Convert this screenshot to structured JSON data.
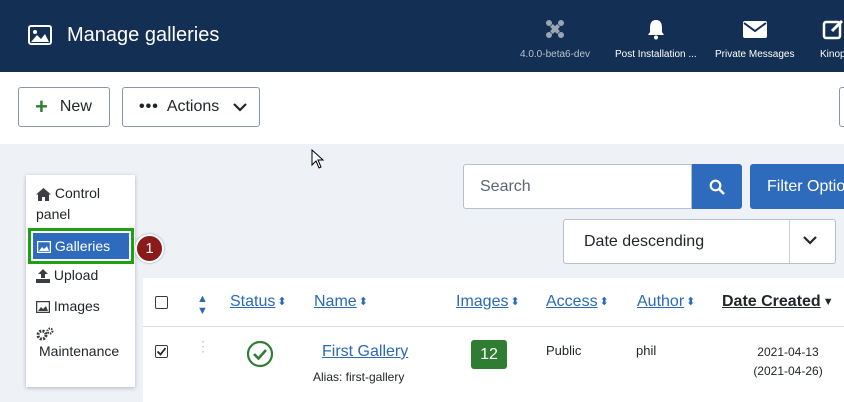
{
  "header": {
    "title": "Manage galleries",
    "items": [
      {
        "label": "4.0.0-beta6-dev",
        "icon": "joomla-icon"
      },
      {
        "label": "Post Installation ...",
        "icon": "bell-icon"
      },
      {
        "label": "Private Messages",
        "icon": "envelope-icon"
      },
      {
        "label": "Kinop",
        "icon": "external-edit-icon"
      }
    ]
  },
  "toolbar": {
    "new_label": "New",
    "actions_label": "Actions"
  },
  "sidebar": {
    "items": [
      {
        "label": "Control panel",
        "icon": "home-icon"
      },
      {
        "label": "Galleries",
        "icon": "image-icon"
      },
      {
        "label": "Upload",
        "icon": "upload-icon"
      },
      {
        "label": "Images",
        "icon": "image-icon"
      },
      {
        "label": "Maintenance",
        "icon": "cogs-icon"
      }
    ],
    "active": "Galleries"
  },
  "annotation_badge": "1",
  "search": {
    "placeholder": "Search",
    "filter_label": "Filter Options"
  },
  "sort": {
    "selected": "Date descending"
  },
  "table": {
    "columns": [
      "Status",
      "Name",
      "Images",
      "Access",
      "Author",
      "Date Created"
    ],
    "rows": [
      {
        "checked": true,
        "status": "published",
        "name": "First Gallery",
        "alias": "Alias: first-gallery",
        "images": "12",
        "access": "Public",
        "author": "phil",
        "date_created": "2021-04-13",
        "date_modified": "(2021-04-26)"
      }
    ]
  },
  "colors": {
    "header": "#132f53",
    "accent": "#2f6bbd",
    "success": "#2e7d32",
    "highlight": "#1ea10e",
    "badge": "#8b1a1a"
  }
}
